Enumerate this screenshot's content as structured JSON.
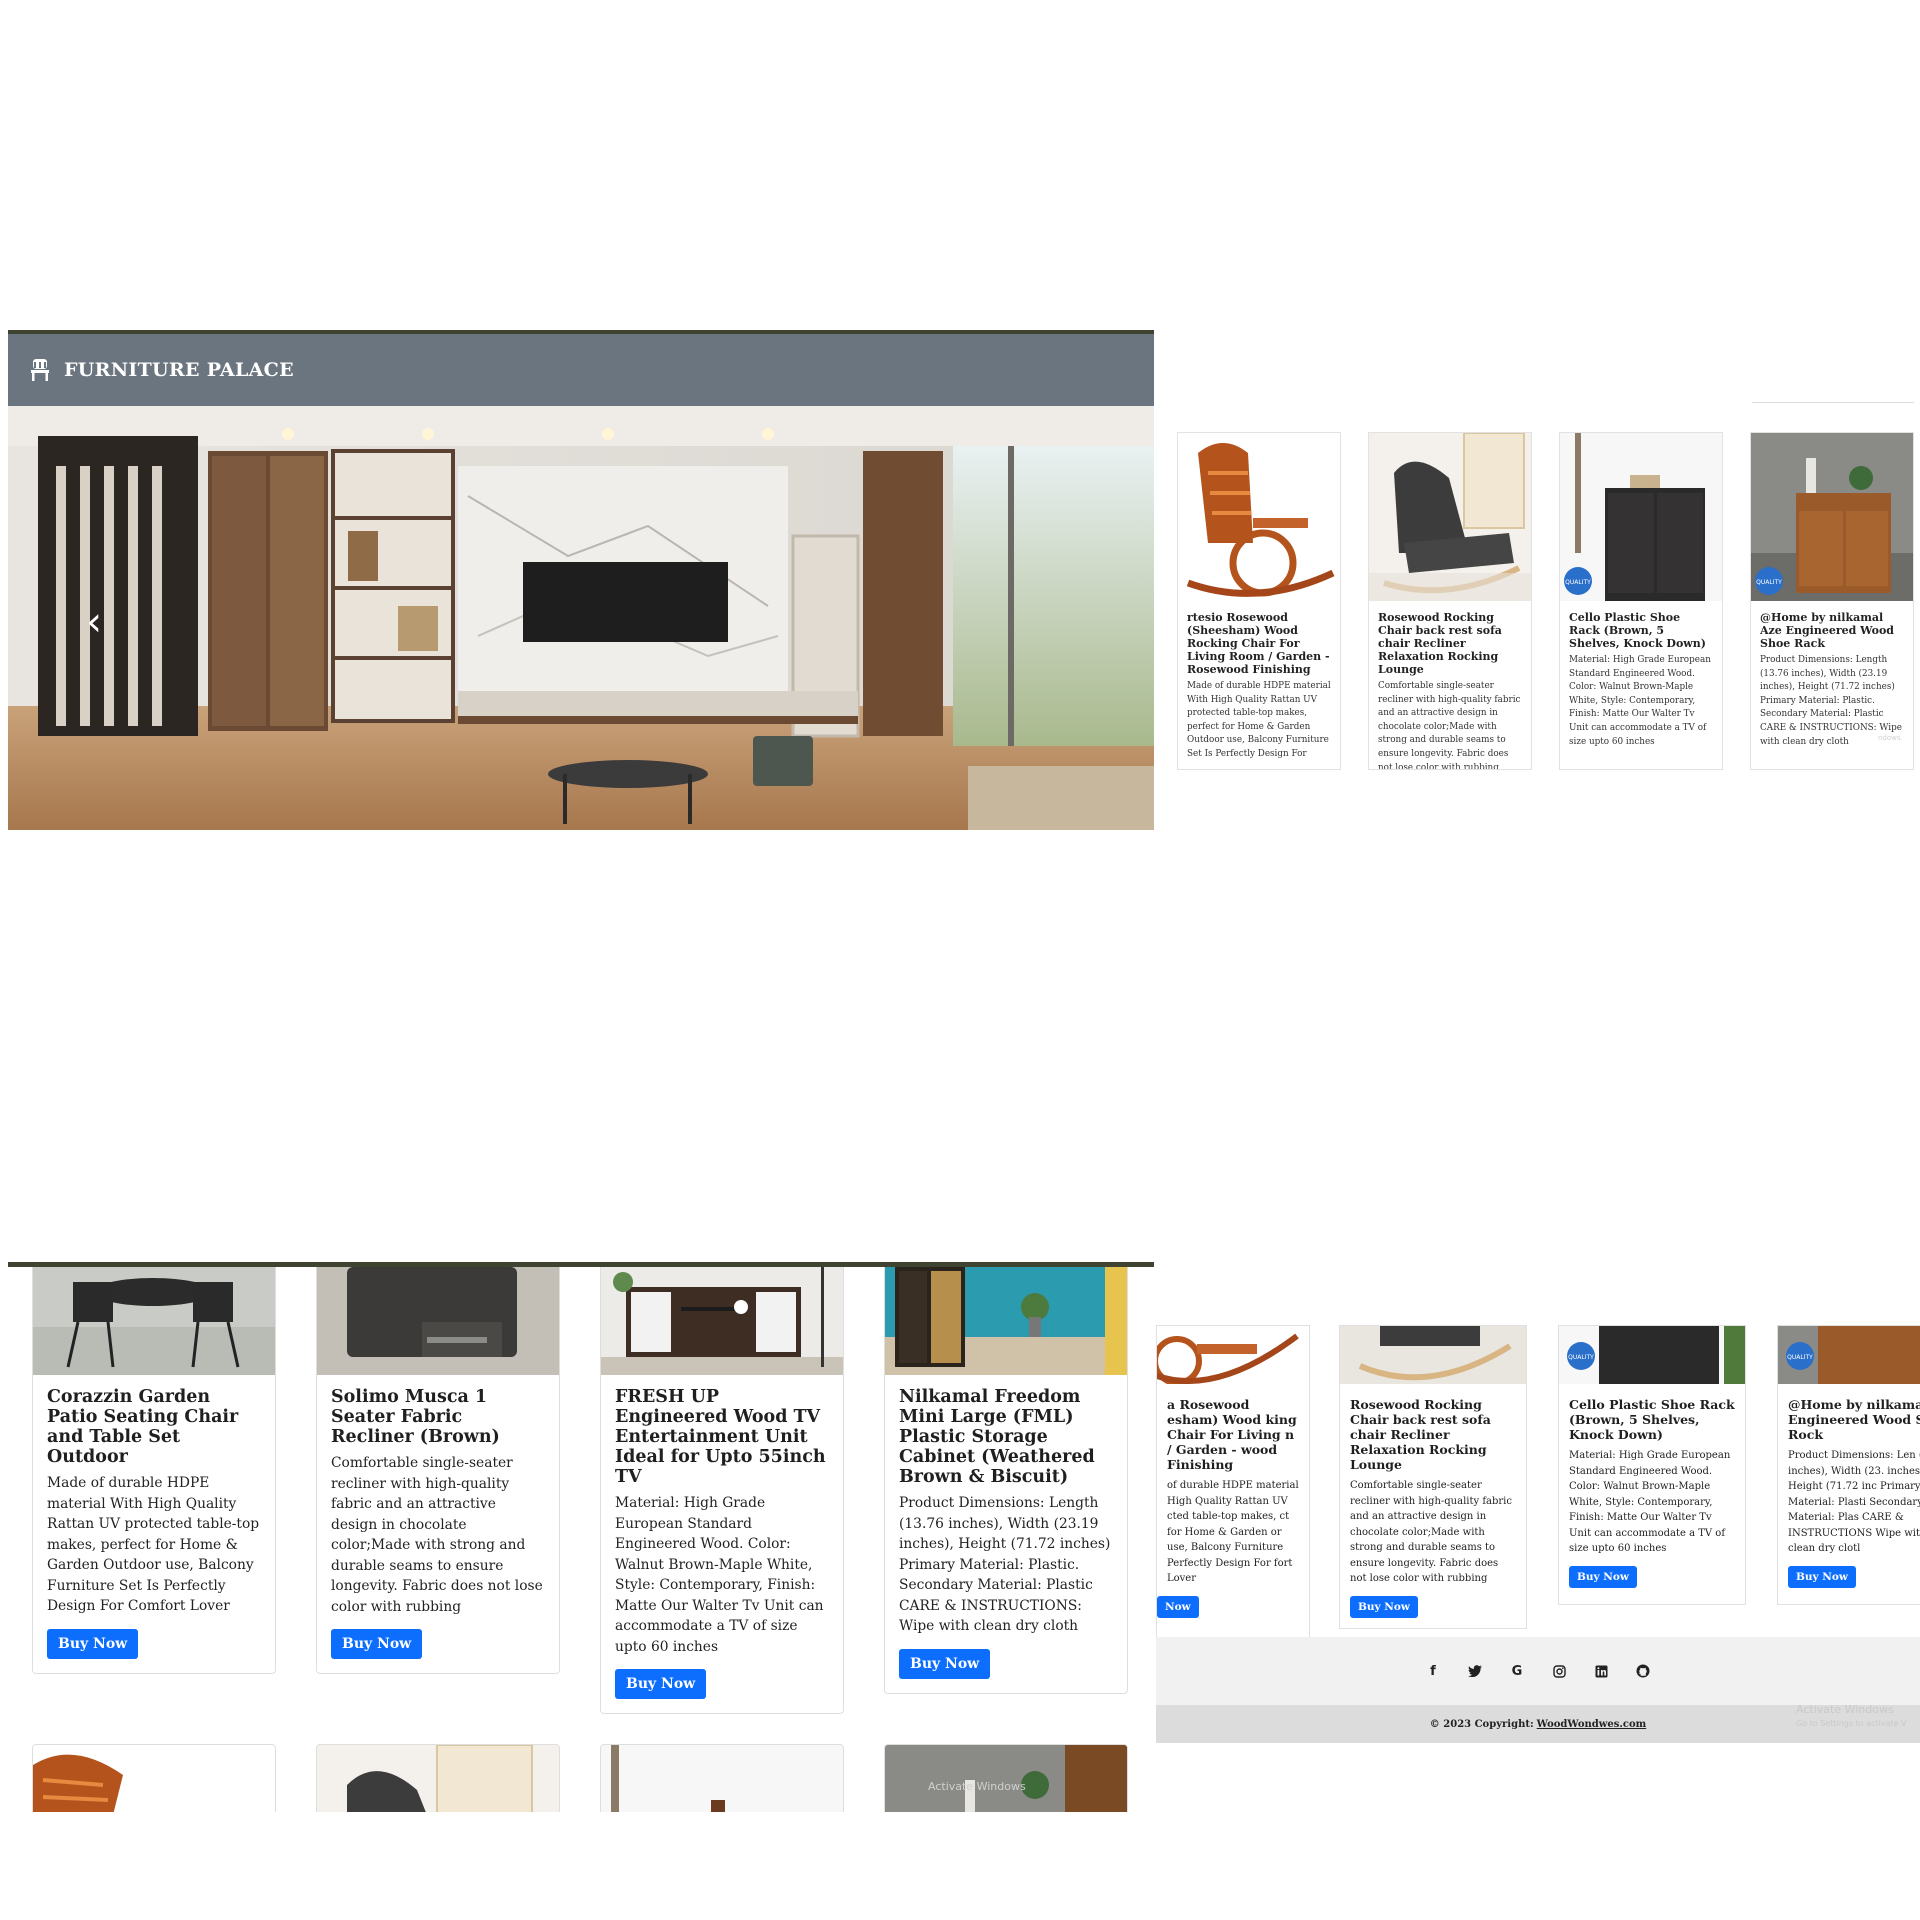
{
  "header": {
    "brand": "FURNITURE PALACE",
    "brand_icon": "chair-icon",
    "bar_color": "#6b7580"
  },
  "hero": {
    "prev_arrow": "‹",
    "image": "living-room-tv-unit-photo"
  },
  "small_cards": [
    {
      "title": "rtesio Rosewood (Sheesham) Wood Rocking Chair For Living Room / Garden - Rosewood Finishing",
      "desc": "Made of durable HDPE material With High Quality Rattan UV protected table-top makes, perfect for Home & Garden Outdoor use, Balcony Furniture Set Is Perfectly Design For"
    },
    {
      "title": "Rosewood Rocking Chair back rest sofa chair Recliner Relaxation Rocking Lounge",
      "desc": "Comfortable single-seater recliner with high-quality fabric and an attractive design in chocolate color;Made with strong and durable seams to ensure longevity. Fabric does not lose color with rubbing"
    },
    {
      "title": "Cello Plastic Shoe Rack (Brown, 5 Shelves, Knock Down)",
      "desc": "Material: High Grade European Standard Engineered Wood. Color: Walnut Brown-Maple White, Style: Contemporary, Finish: Matte Our Walter Tv Unit can accommodate a TV of size upto 60 inches"
    },
    {
      "title": "@Home by nilkamal Aze Engineered Wood Shoe Rack",
      "desc": "Product Dimensions: Length (13.76 inches), Width (23.19 inches), Height (71.72 inches) Primary Material: Plastic. Secondary Material: Plastic CARE & INSTRUCTIONS: Wipe with clean dry cloth"
    }
  ],
  "large_cards": [
    {
      "title": "Corazzin Garden Patio Seating Chair and Table Set Outdoor",
      "desc": "Made of durable HDPE material With High Quality Rattan UV protected table-top makes, perfect for Home & Garden Outdoor use, Balcony Furniture Set Is Perfectly Design For Comfort Lover",
      "button": "Buy Now"
    },
    {
      "title": "Solimo Musca 1 Seater Fabric Recliner (Brown)",
      "desc": "Comfortable single-seater recliner with high-quality fabric and an attractive design in chocolate color;Made with strong and durable seams to ensure longevity. Fabric does not lose color with rubbing",
      "button": "Buy Now"
    },
    {
      "title": "FRESH UP Engineered Wood TV Entertainment Unit Ideal for Upto 55inch TV",
      "desc": "Material: High Grade European Standard Engineered Wood. Color: Walnut Brown-Maple White, Style: Contemporary, Finish: Matte Our Walter Tv Unit can accommodate a TV of size upto 60 inches",
      "button": "Buy Now"
    },
    {
      "title": "Nilkamal Freedom Mini Large (FML) Plastic Storage Cabinet (Weathered Brown & Biscuit)",
      "desc": "Product Dimensions: Length (13.76 inches), Width (23.19 inches), Height (71.72 inches) Primary Material: Plastic. Secondary Material: Plastic CARE & INSTRUCTIONS: Wipe with clean dry cloth",
      "button": "Buy Now"
    }
  ],
  "medium_cards": [
    {
      "title": "a Rosewood esham) Wood king Chair For Living n / Garden - wood Finishing",
      "desc": "of durable HDPE material High Quality Rattan UV cted table-top makes, ct for Home & Garden or use, Balcony Furniture Perfectly Design For fort Lover",
      "button": "Now"
    },
    {
      "title": "Rosewood Rocking Chair back rest sofa chair Recliner Relaxation Rocking Lounge",
      "desc": "Comfortable single-seater recliner with high-quality fabric and an attractive design in chocolate color;Made with strong and durable seams to ensure longevity. Fabric does not lose color with rubbing",
      "button": "Buy Now"
    },
    {
      "title": "Cello Plastic Shoe Rack (Brown, 5 Shelves, Knock Down)",
      "desc": "Material: High Grade European Standard Engineered Wood. Color: Walnut Brown-Maple White, Style: Contemporary, Finish: Matte Our Walter Tv Unit can accommodate a TV of size upto 60 inches",
      "button": "Buy Now"
    },
    {
      "title": "@Home by nilkamal Engineered Wood Sh Rock",
      "desc": "Product Dimensions: Len (13.76 inches), Width (23. inches), Height (71.72 inc Primary Material: Plasti Secondary Material: Plas CARE & INSTRUCTIONS Wipe with clean dry clotl",
      "button": "Buy Now"
    }
  ],
  "footer": {
    "social": [
      {
        "name": "facebook-icon",
        "glyph": "f"
      },
      {
        "name": "twitter-icon",
        "glyph": "t"
      },
      {
        "name": "google-icon",
        "glyph": "G"
      },
      {
        "name": "instagram-icon",
        "glyph": ""
      },
      {
        "name": "linkedin-icon",
        "glyph": "in"
      },
      {
        "name": "github-icon",
        "glyph": ""
      }
    ],
    "copyright_prefix": "© 2023 Copyright:",
    "copyright_link": "WoodWondwes.com"
  },
  "watermark": {
    "title": "Activate Windows",
    "subtitle": "Go to Settings to activate V",
    "tail": "ndows."
  },
  "colors": {
    "accent": "#0d6efd",
    "dark_rule": "#3f4431"
  }
}
